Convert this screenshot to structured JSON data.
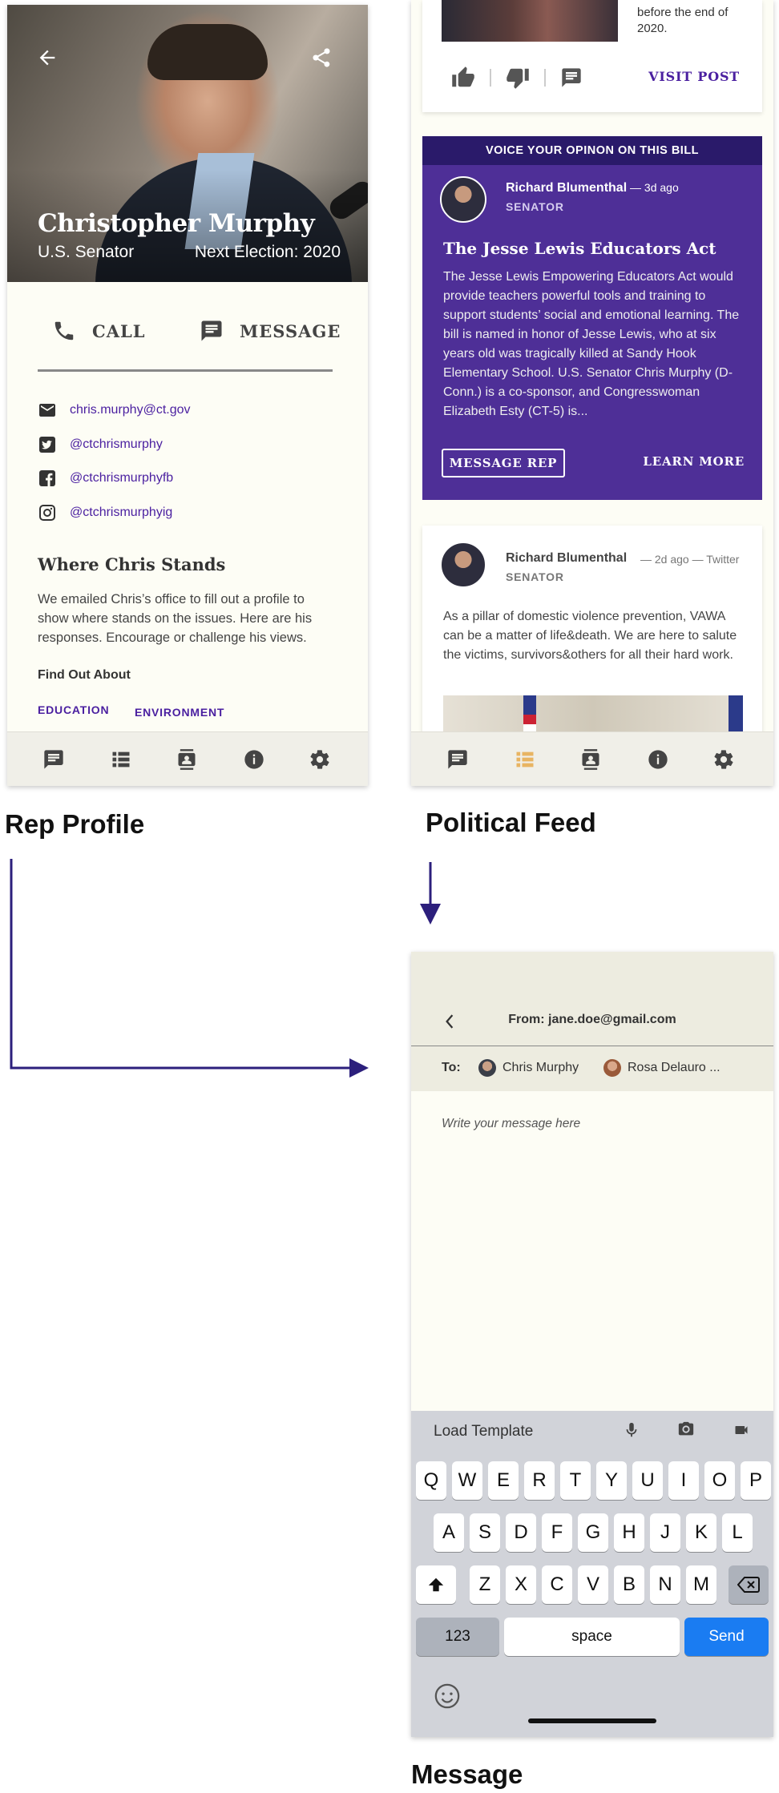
{
  "labels": {
    "rep_profile": "Rep Profile",
    "political_feed": "Political Feed",
    "message": "Message"
  },
  "colors": {
    "accent_purple": "#4a1fa0",
    "banner_purple": "#4e2f97",
    "banner_bar": "#2a1a6a",
    "nav_active": "#e8b462",
    "send_blue": "#1a7cf2"
  },
  "profile": {
    "name": "Christopher Murphy",
    "role": "U.S. Senator",
    "next_election": "Next Election: 2020",
    "call_label": "CALL",
    "message_label": "MESSAGE",
    "contacts": [
      {
        "icon": "email-icon",
        "text": "chris.murphy@ct.gov"
      },
      {
        "icon": "twitter-icon",
        "text": "@ctchrismurphy"
      },
      {
        "icon": "facebook-icon",
        "text": "@ctchrismurphyfb"
      },
      {
        "icon": "instagram-icon",
        "text": "@ctchrismurphyig"
      }
    ],
    "stands_title": "Where Chris Stands",
    "stands_text": "We emailed Chris’s office to fill out a profile to show where stands on the issues. Here are his responses. Encourage or challenge his views.",
    "find_out": "Find Out About",
    "topics": [
      "EDUCATION",
      "ENVIRONMENT"
    ]
  },
  "nav": {
    "items": [
      "chat-icon",
      "feed-icon",
      "contacts-icon",
      "info-icon",
      "settings-icon"
    ]
  },
  "feed": {
    "card1_text": [
      "before the end of",
      "2020."
    ],
    "visit_post": "VISIT POST",
    "opinion_bar": "VOICE YOUR OPINON ON THIS BILL",
    "post1": {
      "author": "Richard Blumenthal",
      "ago": " — 3d ago",
      "role": "SENATOR",
      "title": "The Jesse Lewis Educators Act",
      "body": "The Jesse Lewis Empowering Educators Act would provide teachers powerful tools and training to support students’ social and emotional learning. The bill is named in honor of Jesse Lewis, who at six years old was tragically killed at Sandy Hook Elementary School. U.S. Senator Chris Murphy (D-Conn.) is a co-sponsor, and Congresswoman Elizabeth Esty (CT-5) is...",
      "message_rep": "MESSAGE REP",
      "learn_more": "LEARN MORE"
    },
    "post2": {
      "author": "Richard Blumenthal",
      "meta": "— 2d ago — Twitter",
      "role": "SENATOR",
      "body": "As a pillar of domestic violence prevention, VAWA can be a matter of life&death. We are here to salute the victims, survivors&others for all their hard work."
    }
  },
  "message": {
    "from": "From: jane.doe@gmail.com",
    "to_label": "To:",
    "recipients": [
      "Chris Murphy",
      "Rosa Delauro ..."
    ],
    "placeholder": "Write your message here",
    "load_template": "Load Template",
    "keyboard": {
      "row1": [
        "Q",
        "W",
        "E",
        "R",
        "T",
        "Y",
        "U",
        "I",
        "O",
        "P"
      ],
      "row2": [
        "A",
        "S",
        "D",
        "F",
        "G",
        "H",
        "J",
        "K",
        "L"
      ],
      "row3": [
        "Z",
        "X",
        "C",
        "V",
        "B",
        "N",
        "M"
      ],
      "num": "123",
      "space": "space",
      "send": "Send"
    }
  }
}
